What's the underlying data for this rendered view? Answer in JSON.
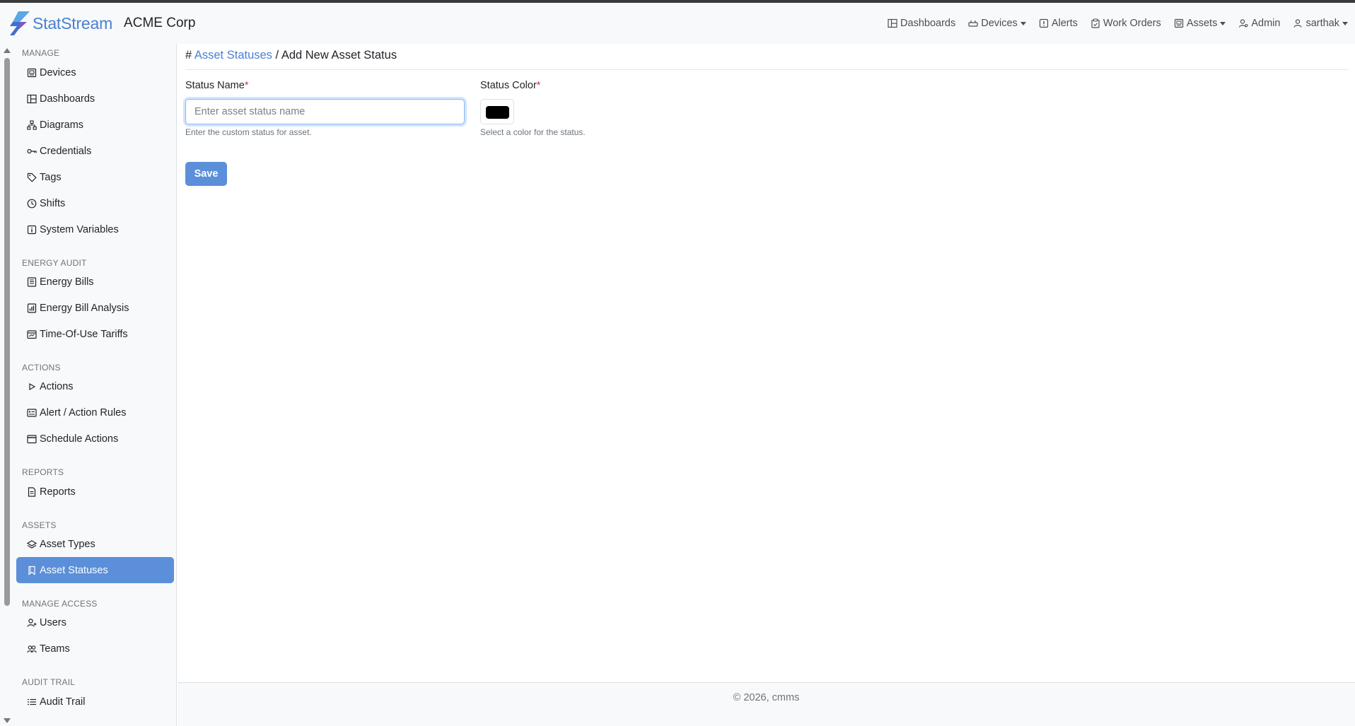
{
  "header": {
    "brand_name": "StatStream",
    "org_name": "ACME Corp",
    "nav": {
      "dashboards": "Dashboards",
      "devices": "Devices",
      "alerts": "Alerts",
      "work_orders": "Work Orders",
      "assets": "Assets",
      "admin": "Admin",
      "user": "sarthak"
    }
  },
  "sidebar": {
    "manage": {
      "label": "MANAGE",
      "items": [
        "Devices",
        "Dashboards",
        "Diagrams",
        "Credentials",
        "Tags",
        "Shifts",
        "System Variables"
      ]
    },
    "energy_audit": {
      "label": "ENERGY AUDIT",
      "items": [
        "Energy Bills",
        "Energy Bill Analysis",
        "Time-Of-Use Tariffs"
      ]
    },
    "actions": {
      "label": "ACTIONS",
      "items": [
        "Actions",
        "Alert / Action Rules",
        "Schedule Actions"
      ]
    },
    "reports": {
      "label": "REPORTS",
      "items": [
        "Reports"
      ]
    },
    "assets": {
      "label": "ASSETS",
      "items": [
        "Asset Types",
        "Asset Statuses"
      ],
      "active_item": "Asset Statuses"
    },
    "manage_access": {
      "label": "MANAGE ACCESS",
      "items": [
        "Users",
        "Teams"
      ]
    },
    "audit_trail": {
      "label": "AUDIT TRAIL",
      "items": [
        "Audit Trail"
      ]
    }
  },
  "breadcrumb": {
    "hash": "#",
    "parent": "Asset Statuses",
    "separator": "/",
    "current": "Add New Asset Status"
  },
  "form": {
    "name_label": "Status Name",
    "name_placeholder": "Enter asset status name",
    "name_value": "",
    "name_help": "Enter the custom status for asset.",
    "color_label": "Status Color",
    "color_value": "#000000",
    "color_help": "Select a color for the status.",
    "required_mark": "*",
    "save_label": "Save"
  },
  "footer": {
    "text": "© 2026, cmms"
  },
  "colors": {
    "accent": "#5b8fd9",
    "link": "#4a7fd4",
    "required": "#dc3545"
  }
}
